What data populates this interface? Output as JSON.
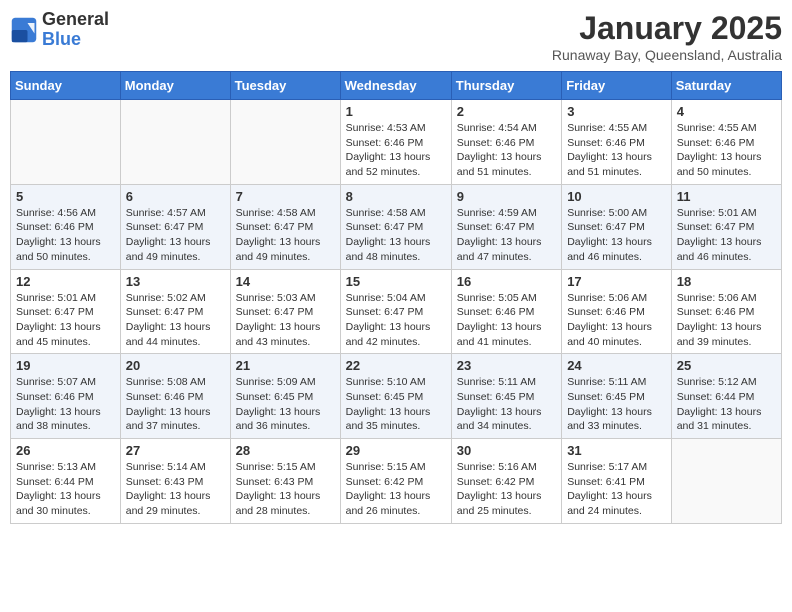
{
  "header": {
    "logo_general": "General",
    "logo_blue": "Blue",
    "month": "January 2025",
    "location": "Runaway Bay, Queensland, Australia"
  },
  "weekdays": [
    "Sunday",
    "Monday",
    "Tuesday",
    "Wednesday",
    "Thursday",
    "Friday",
    "Saturday"
  ],
  "weeks": [
    [
      {
        "day": "",
        "info": ""
      },
      {
        "day": "",
        "info": ""
      },
      {
        "day": "",
        "info": ""
      },
      {
        "day": "1",
        "info": "Sunrise: 4:53 AM\nSunset: 6:46 PM\nDaylight: 13 hours\nand 52 minutes."
      },
      {
        "day": "2",
        "info": "Sunrise: 4:54 AM\nSunset: 6:46 PM\nDaylight: 13 hours\nand 51 minutes."
      },
      {
        "day": "3",
        "info": "Sunrise: 4:55 AM\nSunset: 6:46 PM\nDaylight: 13 hours\nand 51 minutes."
      },
      {
        "day": "4",
        "info": "Sunrise: 4:55 AM\nSunset: 6:46 PM\nDaylight: 13 hours\nand 50 minutes."
      }
    ],
    [
      {
        "day": "5",
        "info": "Sunrise: 4:56 AM\nSunset: 6:46 PM\nDaylight: 13 hours\nand 50 minutes."
      },
      {
        "day": "6",
        "info": "Sunrise: 4:57 AM\nSunset: 6:47 PM\nDaylight: 13 hours\nand 49 minutes."
      },
      {
        "day": "7",
        "info": "Sunrise: 4:58 AM\nSunset: 6:47 PM\nDaylight: 13 hours\nand 49 minutes."
      },
      {
        "day": "8",
        "info": "Sunrise: 4:58 AM\nSunset: 6:47 PM\nDaylight: 13 hours\nand 48 minutes."
      },
      {
        "day": "9",
        "info": "Sunrise: 4:59 AM\nSunset: 6:47 PM\nDaylight: 13 hours\nand 47 minutes."
      },
      {
        "day": "10",
        "info": "Sunrise: 5:00 AM\nSunset: 6:47 PM\nDaylight: 13 hours\nand 46 minutes."
      },
      {
        "day": "11",
        "info": "Sunrise: 5:01 AM\nSunset: 6:47 PM\nDaylight: 13 hours\nand 46 minutes."
      }
    ],
    [
      {
        "day": "12",
        "info": "Sunrise: 5:01 AM\nSunset: 6:47 PM\nDaylight: 13 hours\nand 45 minutes."
      },
      {
        "day": "13",
        "info": "Sunrise: 5:02 AM\nSunset: 6:47 PM\nDaylight: 13 hours\nand 44 minutes."
      },
      {
        "day": "14",
        "info": "Sunrise: 5:03 AM\nSunset: 6:47 PM\nDaylight: 13 hours\nand 43 minutes."
      },
      {
        "day": "15",
        "info": "Sunrise: 5:04 AM\nSunset: 6:47 PM\nDaylight: 13 hours\nand 42 minutes."
      },
      {
        "day": "16",
        "info": "Sunrise: 5:05 AM\nSunset: 6:46 PM\nDaylight: 13 hours\nand 41 minutes."
      },
      {
        "day": "17",
        "info": "Sunrise: 5:06 AM\nSunset: 6:46 PM\nDaylight: 13 hours\nand 40 minutes."
      },
      {
        "day": "18",
        "info": "Sunrise: 5:06 AM\nSunset: 6:46 PM\nDaylight: 13 hours\nand 39 minutes."
      }
    ],
    [
      {
        "day": "19",
        "info": "Sunrise: 5:07 AM\nSunset: 6:46 PM\nDaylight: 13 hours\nand 38 minutes."
      },
      {
        "day": "20",
        "info": "Sunrise: 5:08 AM\nSunset: 6:46 PM\nDaylight: 13 hours\nand 37 minutes."
      },
      {
        "day": "21",
        "info": "Sunrise: 5:09 AM\nSunset: 6:45 PM\nDaylight: 13 hours\nand 36 minutes."
      },
      {
        "day": "22",
        "info": "Sunrise: 5:10 AM\nSunset: 6:45 PM\nDaylight: 13 hours\nand 35 minutes."
      },
      {
        "day": "23",
        "info": "Sunrise: 5:11 AM\nSunset: 6:45 PM\nDaylight: 13 hours\nand 34 minutes."
      },
      {
        "day": "24",
        "info": "Sunrise: 5:11 AM\nSunset: 6:45 PM\nDaylight: 13 hours\nand 33 minutes."
      },
      {
        "day": "25",
        "info": "Sunrise: 5:12 AM\nSunset: 6:44 PM\nDaylight: 13 hours\nand 31 minutes."
      }
    ],
    [
      {
        "day": "26",
        "info": "Sunrise: 5:13 AM\nSunset: 6:44 PM\nDaylight: 13 hours\nand 30 minutes."
      },
      {
        "day": "27",
        "info": "Sunrise: 5:14 AM\nSunset: 6:43 PM\nDaylight: 13 hours\nand 29 minutes."
      },
      {
        "day": "28",
        "info": "Sunrise: 5:15 AM\nSunset: 6:43 PM\nDaylight: 13 hours\nand 28 minutes."
      },
      {
        "day": "29",
        "info": "Sunrise: 5:15 AM\nSunset: 6:42 PM\nDaylight: 13 hours\nand 26 minutes."
      },
      {
        "day": "30",
        "info": "Sunrise: 5:16 AM\nSunset: 6:42 PM\nDaylight: 13 hours\nand 25 minutes."
      },
      {
        "day": "31",
        "info": "Sunrise: 5:17 AM\nSunset: 6:41 PM\nDaylight: 13 hours\nand 24 minutes."
      },
      {
        "day": "",
        "info": ""
      }
    ]
  ]
}
